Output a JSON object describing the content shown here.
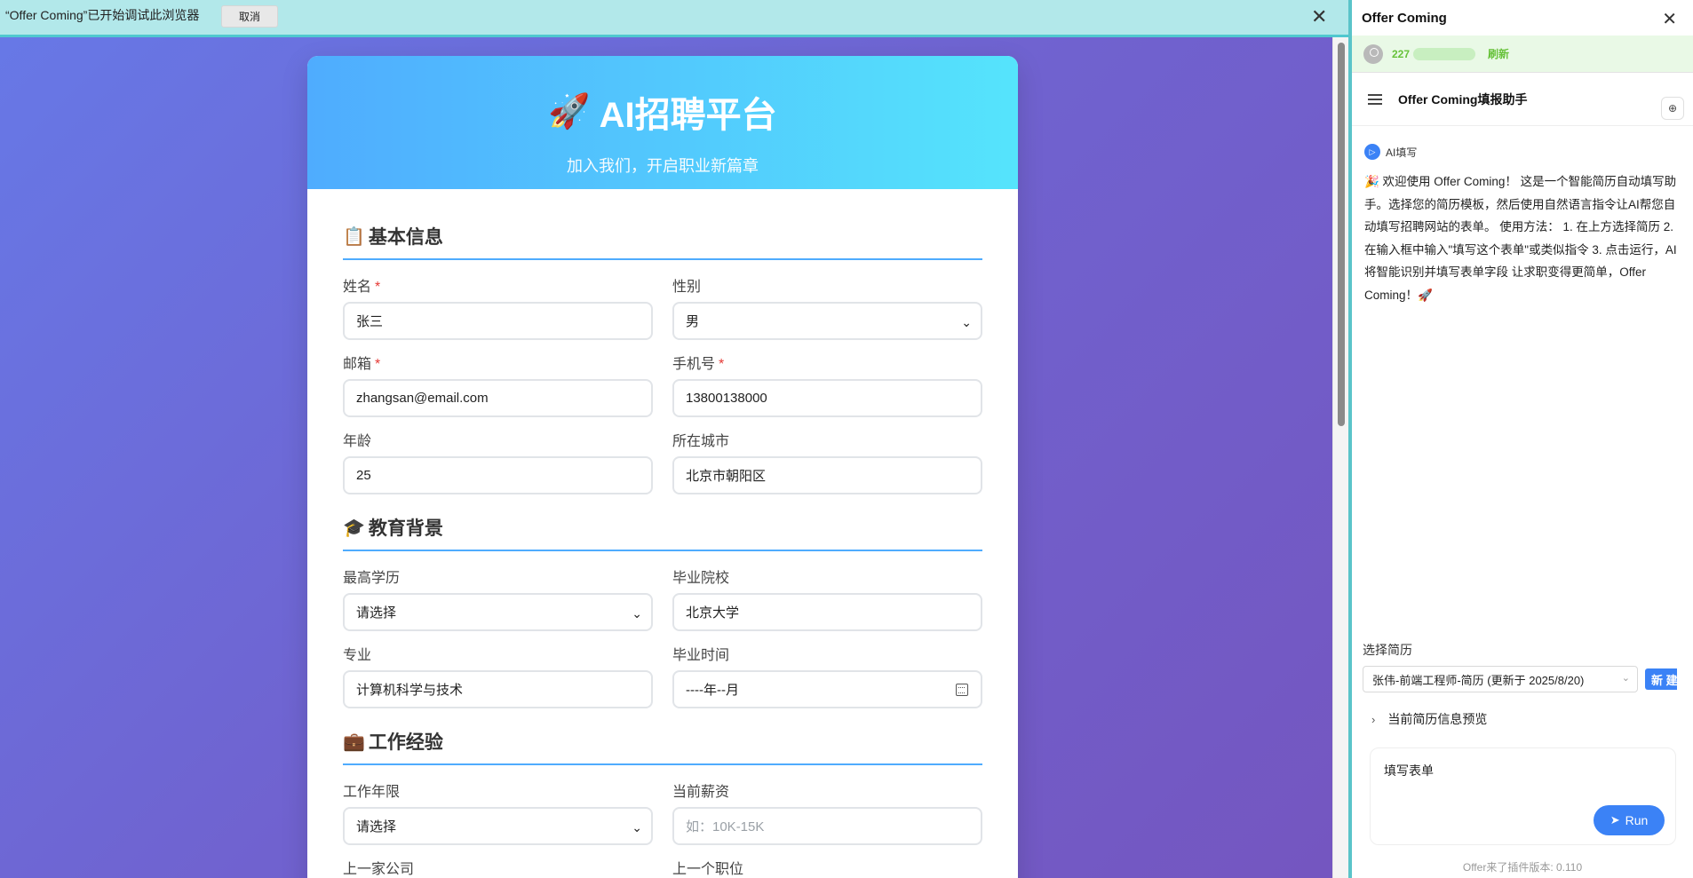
{
  "debug_bar": {
    "message": "“Offer Coming”已开始调试此浏览器",
    "cancel_label": "取消",
    "close_glyph": "✕"
  },
  "form_page": {
    "title_icon": "🚀",
    "title": "AI招聘平台",
    "subtitle": "加入我们，开启职业新篇章",
    "sections": {
      "basic": {
        "icon": "📋",
        "title": "基本信息"
      },
      "education": {
        "icon": "🎓",
        "title": "教育背景"
      },
      "work": {
        "icon": "💼",
        "title": "工作经验"
      }
    },
    "fields": {
      "name": {
        "label": "姓名",
        "required": "*",
        "value": "张三"
      },
      "gender": {
        "label": "性别",
        "value": "男"
      },
      "email": {
        "label": "邮箱",
        "required": "*",
        "value": "zhangsan@email.com"
      },
      "phone": {
        "label": "手机号",
        "required": "*",
        "value": "13800138000"
      },
      "age": {
        "label": "年龄",
        "value": "25"
      },
      "city": {
        "label": "所在城市",
        "value": "北京市朝阳区"
      },
      "degree": {
        "label": "最高学历",
        "value": "请选择"
      },
      "school": {
        "label": "毕业院校",
        "value": "北京大学"
      },
      "major": {
        "label": "专业",
        "value": "计算机科学与技术"
      },
      "grad_time": {
        "label": "毕业时间",
        "value": "----年--月"
      },
      "work_years": {
        "label": "工作年限",
        "value": "请选择"
      },
      "salary": {
        "label": "当前薪资",
        "placeholder": "如：10K-15K"
      },
      "last_company": {
        "label": "上一家公司"
      },
      "last_position": {
        "label": "上一个职位"
      }
    }
  },
  "panel": {
    "title": "Offer Coming",
    "close_glyph": "✕",
    "user_id_visible": "227",
    "refresh_label": "刷新",
    "assistant_title": "Offer Coming填报助手",
    "message": {
      "author": "AI填写",
      "text": "🎉 欢迎使用 Offer Coming！ 这是一个智能简历自动填写助手。选择您的简历模板，然后使用自然语言指令让AI帮您自动填写招聘网站的表单。 使用方法： 1. 在上方选择简历 2. 在输入框中输入\"填写这个表单\"或类似指令 3. 点击运行，AI将智能识别并填写表单字段 让求职变得更简单，Offer Coming！🚀"
    },
    "resume_label": "选择简历",
    "resume_selected": "张伟-前端工程师-简历 (更新于 2025/8/20)",
    "new_button": "新 建",
    "preview_label": "当前简历信息预览",
    "prompt_text": "填写表单",
    "run_label": "Run",
    "version": "Offer来了插件版本: 0.110"
  }
}
